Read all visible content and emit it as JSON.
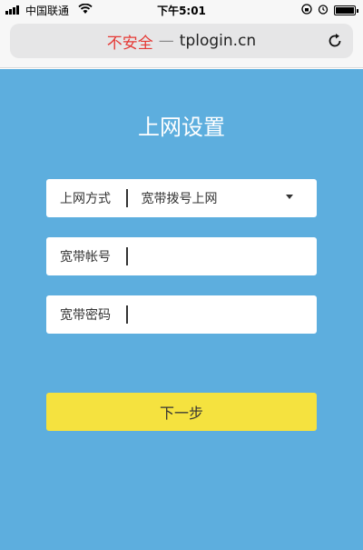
{
  "status_bar": {
    "carrier": "中国联通",
    "time": "下午5:01"
  },
  "address_bar": {
    "insecure_label": "不安全",
    "separator": "—",
    "url": "tplogin.cn"
  },
  "page": {
    "title": "上网设置",
    "fields": [
      {
        "label": "上网方式",
        "value": "宽带拨号上网"
      },
      {
        "label": "宽带帐号",
        "value": ""
      },
      {
        "label": "宽带密码",
        "value": ""
      }
    ],
    "next_button_label": "下一步"
  },
  "colors": {
    "background": "#5daede",
    "button": "#f5e23f",
    "insecure": "#e53935"
  }
}
